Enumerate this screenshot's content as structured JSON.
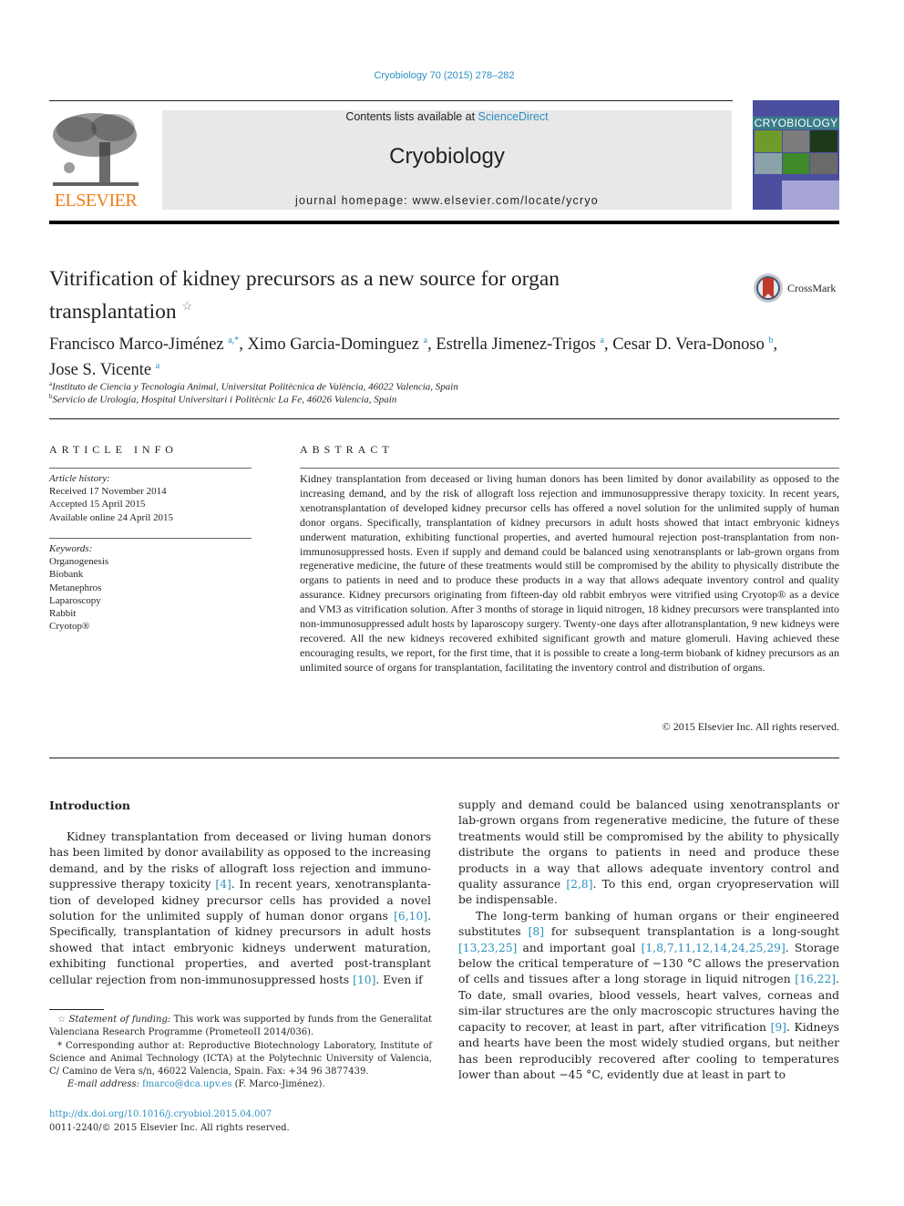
{
  "header": {
    "citation": "Cryobiology 70 (2015) 278–282",
    "contents_prefix": "Contents lists available at ",
    "contents_link": "ScienceDirect",
    "journal_title": "Cryobiology",
    "homepage_prefix": "journal homepage: ",
    "homepage_url": "www.elsevier.com/locate/ycryo",
    "publisher_logo_text": "ELSEVIER",
    "cover_title": "CRYOBIOLOGY",
    "colors": {
      "link": "#2c8fbf",
      "elsevier_orange": "#f07f1a",
      "banner_bg": "#e8e8e8",
      "cover_blue": "#4b4e9e"
    }
  },
  "article": {
    "title_line1": "Vitrification of kidney precursors as a new source for organ",
    "title_line2": "transplantation",
    "title_note_mark": "☆",
    "crossmark_label": "CrossMark",
    "authors": [
      {
        "name": "Francisco Marco-Jiménez",
        "sup": "a,*",
        "sep": ", "
      },
      {
        "name": "Ximo Garcia-Dominguez",
        "sup": "a",
        "sep": ", "
      },
      {
        "name": "Estrella Jimenez-Trigos",
        "sup": "a",
        "sep": ", "
      },
      {
        "name": "Cesar D. Vera-Donoso",
        "sup": "b",
        "sep": ","
      },
      {
        "name": "Jose S. Vicente",
        "sup": "a",
        "sep": ""
      }
    ],
    "affiliations": [
      {
        "mark": "a",
        "text": "Instituto de Ciencia y Tecnología Animal, Universitat Politècnica de València, 46022 Valencia, Spain"
      },
      {
        "mark": "b",
        "text": "Servicio de Urología, Hospital Universitari i Politècnic La Fe, 46026 Valencia, Spain"
      }
    ]
  },
  "article_info": {
    "heading": "ARTICLE INFO",
    "history_label": "Article history:",
    "history": [
      "Received 17 November 2014",
      "Accepted 15 April 2015",
      "Available online 24 April 2015"
    ],
    "keywords_label": "Keywords:",
    "keywords": [
      "Organogenesis",
      "Biobank",
      "Metanephros",
      "Laparoscopy",
      "Rabbit",
      "Cryotop®"
    ]
  },
  "abstract": {
    "heading": "ABSTRACT",
    "text": "Kidney transplantation from deceased or living human donors has been limited by donor availability as opposed to the increasing demand, and by the risk of allograft loss rejection and immunosuppressive therapy toxicity. In recent years, xenotransplantation of developed kidney precursor cells has offered a novel solution for the unlimited supply of human donor organs. Specifically, transplantation of kidney precursors in adult hosts showed that intact embryonic kidneys underwent maturation, exhibiting functional properties, and averted humoural rejection post-transplantation from non-immunosuppressed hosts. Even if supply and demand could be balanced using xenotransplants or lab-grown organs from regenerative medicine, the future of these treatments would still be compromised by the ability to physically distribute the organs to patients in need and to produce these products in a way that allows adequate inventory control and quality assurance. Kidney precursors originating from fifteen-day old rabbit embryos were vitrified using Cryotop® as a device and VM3 as vitrification solution. After 3 months of storage in liquid nitrogen, 18 kidney precursors were transplanted into non-immunosuppressed adult hosts by laparoscopy surgery. Twenty-one days after allotransplantation, 9 new kidneys were recovered. All the new kidneys recovered exhibited significant growth and mature glomeruli. Having achieved these encouraging results, we report, for the first time, that it is possible to create a long-term biobank of kidney precursors as an unlimited source of organs for transplantation, facilitating the inventory control and distribution of organs.",
    "copyright": "© 2015 Elsevier Inc. All rights reserved."
  },
  "body": {
    "intro_heading": "Introduction",
    "left_col": [
      {
        "t": "Kidney transplantation from deceased or living human donors has been limited by donor availability as opposed to the increasing demand, and by the risks of allograft loss rejection and immuno-suppressive therapy toxicity "
      },
      {
        "ref": "[4]"
      },
      {
        "t": ". In recent years, xenotransplanta-tion of developed kidney precursor cells has provided a novel solution for the unlimited supply of human donor organs "
      },
      {
        "ref": "[6,10]"
      },
      {
        "t": ". Specifically, transplantation of kidney precursors in adult hosts showed that intact embryonic kidneys underwent maturation, exhibiting functional properties, and averted post-transplant cellular rejection from non-immunosuppressed hosts "
      },
      {
        "ref": "[10]"
      },
      {
        "t": ". Even if"
      }
    ],
    "right_col_p1": [
      {
        "t": "supply and demand could be balanced using xenotransplants or lab-grown organs from regenerative medicine, the future of these treatments would still be compromised by the ability to physically distribute the organs to patients in need and produce these products in a way that allows adequate inventory control and quality assurance "
      },
      {
        "ref": "[2,8]"
      },
      {
        "t": ". To this end, organ cryopreservation will be indispensable."
      }
    ],
    "right_col_p2": [
      {
        "t": "The long-term banking of human organs or their engineered substitutes "
      },
      {
        "ref": "[8]"
      },
      {
        "t": " for subsequent transplantation is a long-sought "
      },
      {
        "ref": "[13,23,25]"
      },
      {
        "t": " and important goal "
      },
      {
        "ref": "[1,8,7,11,12,14,24,25,29]"
      },
      {
        "t": ". Storage below the critical temperature of −130 °C allows the preservation of cells and tissues after a long storage in liquid nitrogen "
      },
      {
        "ref": "[16,22]"
      },
      {
        "t": ". To date, small ovaries, blood vessels, heart valves, corneas and sim-ilar structures are the only macroscopic structures having the capacity to recover, at least in part, after vitrification "
      },
      {
        "ref": "[9]"
      },
      {
        "t": ". Kidneys and hearts have been the most widely studied organs, but neither has been reproducibly recovered after cooling to temperatures lower than about −45 °C, evidently due at least in part to"
      }
    ]
  },
  "footnotes": {
    "funding_mark": "☆",
    "funding_label": "Statement of funding:",
    "funding_text": " This work was supported by funds from the Generalitat Valenciana Research Programme (PrometeoII 2014/036).",
    "corresponding_mark": "*",
    "corresponding_text": " Corresponding author at: Reproductive Biotechnology Laboratory, Institute of Science and Animal Technology (ICTA) at the Polytechnic University of Valencia, C/ Camino de Vera s/n, 46022 Valencia, Spain. Fax: +34 96 3877439.",
    "email_label": "E-mail address:",
    "email": "fmarco@dca.upv.es",
    "email_suffix": " (F. Marco-Jiménez).",
    "doi": "http://dx.doi.org/10.1016/j.cryobiol.2015.04.007",
    "issn_line": "0011-2240/© 2015 Elsevier Inc. All rights reserved."
  }
}
